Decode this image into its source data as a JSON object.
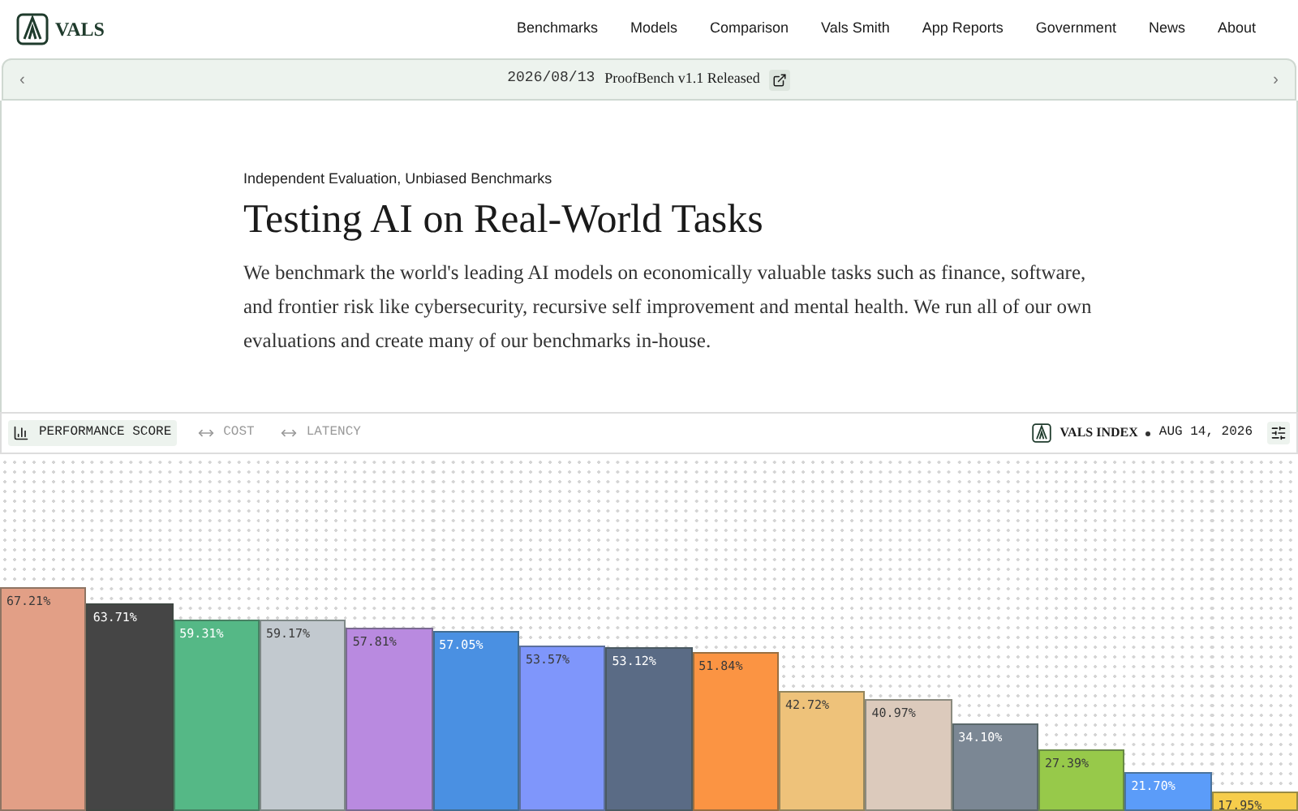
{
  "nav": {
    "logo": "VALS",
    "links": [
      "Benchmarks",
      "Models",
      "Comparison",
      "Vals Smith",
      "App Reports",
      "Government",
      "News",
      "About"
    ]
  },
  "announcement": {
    "date": "2026/08/13",
    "text": "ProofBench v1.1 Released",
    "prev": "‹",
    "next": "›"
  },
  "hero": {
    "eyebrow": "Independent Evaluation, Unbiased Benchmarks",
    "title": "Testing AI on Real-World Tasks",
    "body": "We benchmark the world's leading AI models on economically valuable tasks such as finance, software, and frontier risk like cybersecurity, recursive self improvement and mental health. We run all of our own evaluations and create many of our benchmarks in-house."
  },
  "chart_panel": {
    "tabs": [
      {
        "label": "PERFORMANCE SCORE",
        "selected": true
      },
      {
        "label": "COST",
        "selected": false
      },
      {
        "label": "LATENCY",
        "selected": false
      }
    ],
    "index_label": "VALS INDEX",
    "date": "AUG 14, 2026",
    "bars": [
      {
        "label": "67.21%",
        "level": 0.627,
        "color": "#e29f86"
      },
      {
        "label": "63.71%",
        "level": 0.582,
        "color": "#454545"
      },
      {
        "label": "59.31%",
        "level": 0.536,
        "color": "#55b886"
      },
      {
        "label": "59.17%",
        "level": 0.536,
        "color": "#c2c9cf"
      },
      {
        "label": "57.81%",
        "level": 0.514,
        "color": "#b98ae0"
      },
      {
        "label": "57.05%",
        "level": 0.505,
        "color": "#4a90e2"
      },
      {
        "label": "53.57%",
        "level": 0.464,
        "color": "#7f96fb"
      },
      {
        "label": "53.12%",
        "level": 0.459,
        "color": "#5a6b85"
      },
      {
        "label": "51.84%",
        "level": 0.445,
        "color": "#fb9443"
      },
      {
        "label": "42.72%",
        "level": 0.336,
        "color": "#eec27a"
      },
      {
        "label": "40.97%",
        "level": 0.314,
        "color": "#dccabc"
      },
      {
        "label": "34.10%",
        "level": 0.245,
        "color": "#7b8794"
      },
      {
        "label": "27.39%",
        "level": 0.173,
        "color": "#97c94a"
      },
      {
        "label": "21.70%",
        "level": 0.109,
        "color": "#5b9cf9"
      },
      {
        "label": "17.95%",
        "level": 0.055,
        "color": "#f6cd4b"
      }
    ]
  }
}
